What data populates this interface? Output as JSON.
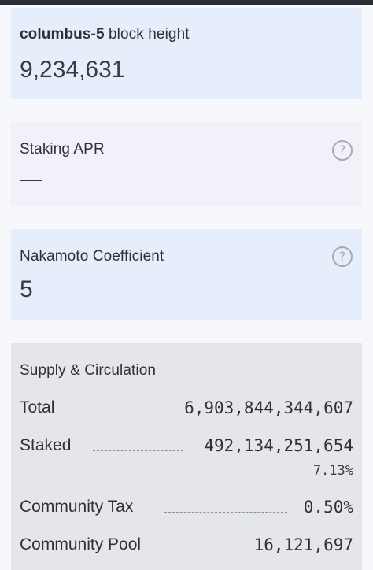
{
  "block": {
    "chain": "columbus-5",
    "label": "block height",
    "value": "9,234,631"
  },
  "staking_apr": {
    "label": "Staking APR",
    "value": "—",
    "help_icon": "question-circle-icon"
  },
  "nakamoto": {
    "label": "Nakamoto Coefficient",
    "value": "5",
    "help_icon": "question-circle-icon"
  },
  "supply": {
    "title": "Supply & Circulation",
    "rows": [
      {
        "label": "Total",
        "value": "6,903,844,344,607"
      },
      {
        "label": "Staked",
        "value": "492,134,251,654",
        "sub": "7.13%"
      },
      {
        "label": "Community Tax",
        "value": "0.50%"
      },
      {
        "label": "Community Pool",
        "value": "16,121,697"
      }
    ]
  },
  "colors": {
    "card_blue": "#e6eefb",
    "card_lavender": "#f1f1fa",
    "card_gray": "#e5e6ea",
    "text": "#2f3136",
    "icon": "#a8aab3"
  }
}
